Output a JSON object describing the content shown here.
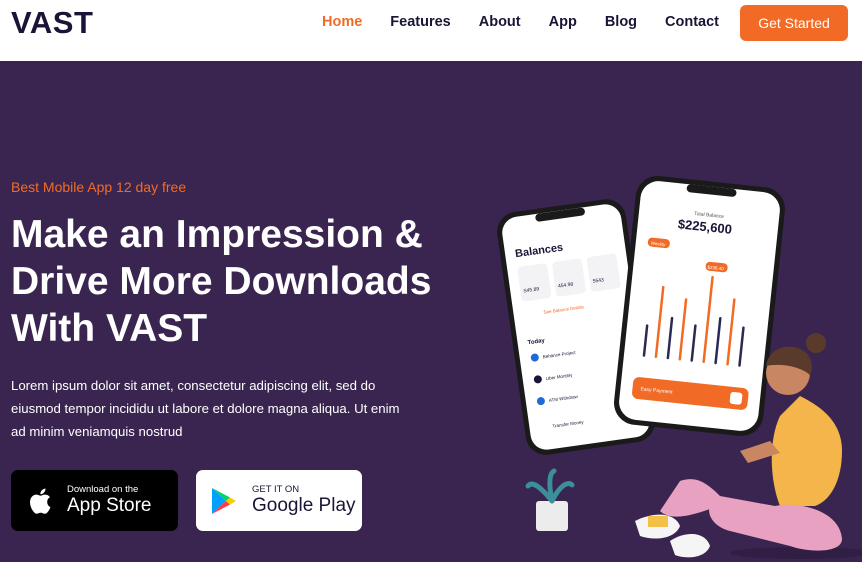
{
  "brand": {
    "logo": "VAST"
  },
  "nav": {
    "items": [
      {
        "label": "Home",
        "active": true
      },
      {
        "label": "Features",
        "active": false
      },
      {
        "label": "About",
        "active": false
      },
      {
        "label": "App",
        "active": false
      },
      {
        "label": "Blog",
        "active": false
      },
      {
        "label": "Contact",
        "active": false
      }
    ],
    "cta_label": "Get Started"
  },
  "hero": {
    "tagline": "Best Mobile App 12 day free",
    "headline_lines": [
      "Make an Impression &",
      "Drive More Downloads",
      "With VAST"
    ],
    "paragraph": "Lorem ipsum dolor sit amet, consectetur adipiscing elit, sed do eiusmod tempor incididu ut labore et dolore magna aliqua. Ut enim ad minim veniamquis nostrud"
  },
  "stores": {
    "apple": {
      "small": "Download on the",
      "big": "App Store"
    },
    "google": {
      "small": "GET IT ON",
      "big": "Google Play"
    }
  },
  "phone_left": {
    "title": "Balances",
    "card1": "S45.89",
    "card2": "454.98",
    "card3": "5543",
    "action": "See Balance Details",
    "section": "Today",
    "rows": [
      "Behance Project",
      "Uber Monthly",
      "ATM Withdraw",
      "Transfer Money"
    ]
  },
  "phone_right": {
    "label": "Total Balance",
    "amount": "$225,600",
    "pill": "Weekly",
    "tooltip": "$236.40",
    "footer": "Easy Payment"
  },
  "colors": {
    "accent": "#f26b26",
    "hero_bg": "#3a2550",
    "dark": "#1c1436"
  }
}
